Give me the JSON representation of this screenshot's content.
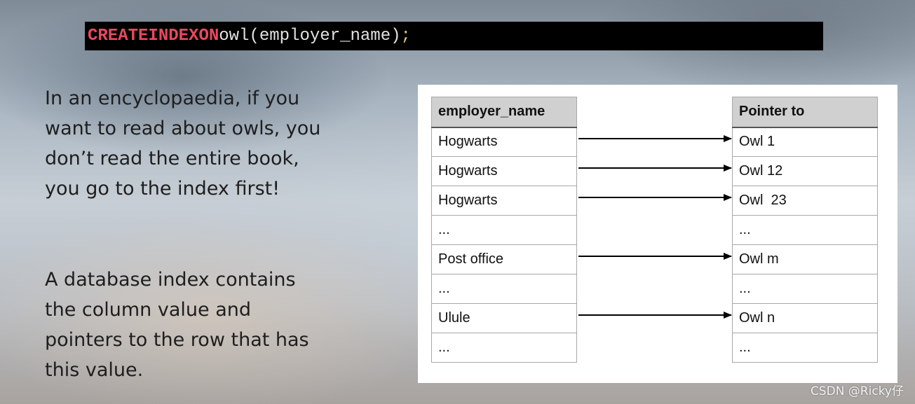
{
  "code": {
    "kw_create": "CREATE",
    "kw_index": "INDEX",
    "kw_on": "ON",
    "table_name": "owl",
    "column_expr": "(employer_name)",
    "terminator": ";"
  },
  "text": {
    "paragraph_1": "In an encyclopaedia, if you want to read about owls, you don’t read the entire book, you go to the index first!",
    "paragraph_2": "A database index contains the column value and pointers to the row that has this value."
  },
  "index_table": {
    "left_header": "employer_name",
    "right_header": "Pointer to",
    "left_values": [
      "Hogwarts",
      "Hogwarts",
      "Hogwarts",
      "...",
      "Post office",
      "...",
      "Ulule",
      "..."
    ],
    "right_values": [
      "Owl 1",
      "Owl 12",
      "Owl  23",
      "...",
      "Owl m",
      "...",
      "Owl n",
      "..."
    ],
    "arrow_rows": [
      0,
      1,
      2,
      4,
      6
    ]
  },
  "watermark": "CSDN @Ricky仔"
}
